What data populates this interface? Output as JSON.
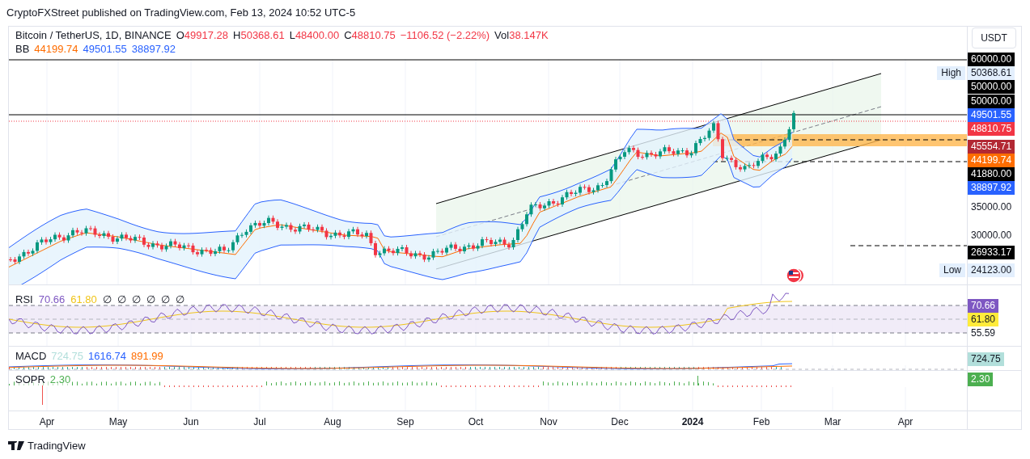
{
  "header": "CryptoFXStreet published on TradingView.com, Feb 13, 2024 10:52 UTC-5",
  "legend": {
    "symbol": "Bitcoin / TetherUS, 1D, BINANCE",
    "ohlc": [
      {
        "label": "O",
        "value": "49917.28"
      },
      {
        "label": "H",
        "value": "50368.61"
      },
      {
        "label": "L",
        "value": "48400.00"
      },
      {
        "label": "C",
        "value": "48810.75"
      }
    ],
    "change": "−1106.52 (−2.22%)",
    "volume": {
      "label": "Vol",
      "value": "38.147K"
    }
  },
  "bb": {
    "label": "BB",
    "values": [
      {
        "text": "44199.74",
        "color": "#ff6d00"
      },
      {
        "text": "49501.55",
        "color": "#2962ff"
      },
      {
        "text": "38897.92",
        "color": "#2962ff"
      }
    ]
  },
  "currency": "USDT",
  "price_labels": [
    {
      "text": "60000.00",
      "kind": "tag",
      "color": "#000000"
    },
    {
      "text": "50368.61",
      "kind": "tag",
      "color": "#e3effd",
      "marker": "High"
    },
    {
      "text": "50000.00",
      "kind": "tag",
      "color": "#000000"
    },
    {
      "text": "50000.00",
      "kind": "tag",
      "color": "#000000"
    },
    {
      "text": "49501.55",
      "kind": "tag",
      "color": "#2962ff"
    },
    {
      "text": "48810.75",
      "kind": "tag",
      "color": "#f23645"
    },
    {
      "text": "45554.71",
      "kind": "tag",
      "color": "#b22833"
    },
    {
      "text": "44199.74",
      "kind": "tag",
      "color": "#ff6d00"
    },
    {
      "text": "41880.00",
      "kind": "tag",
      "color": "#000000"
    },
    {
      "text": "38897.92",
      "kind": "tag",
      "color": "#2962ff"
    },
    {
      "text": "35000.00",
      "kind": "plain"
    },
    {
      "text": "30000.00",
      "kind": "plain"
    },
    {
      "text": "26933.17",
      "kind": "tag",
      "color": "#000000"
    },
    {
      "text": "24123.00",
      "kind": "tag",
      "color": "#e3effd",
      "marker": "Low"
    }
  ],
  "rsi": {
    "label": "RSI",
    "values": [
      {
        "text": "70.66",
        "color": "#7e57c2"
      },
      {
        "text": "61.80",
        "color": "#f0c419"
      }
    ],
    "empty_inputs": [
      "∅",
      "∅",
      "∅",
      "∅",
      "∅",
      "∅"
    ],
    "axis": [
      {
        "text": "70.66",
        "kind": "tag",
        "color": "#7e57c2"
      },
      {
        "text": "61.80",
        "kind": "tag",
        "color": "#ffeb3b"
      },
      {
        "text": "55.59",
        "kind": "plain"
      }
    ]
  },
  "macd": {
    "label": "MACD",
    "values": [
      {
        "text": "724.75",
        "color": "#b2dfdb"
      },
      {
        "text": "1616.74",
        "color": "#2962ff"
      },
      {
        "text": "891.99",
        "color": "#ff6d00"
      }
    ],
    "axis": [
      {
        "text": "724.75",
        "kind": "tag",
        "color": "#b2dfdb"
      }
    ]
  },
  "sopr": {
    "label": "SOPR",
    "values": [
      {
        "text": "2.30",
        "color": "#4caf50"
      }
    ],
    "axis": [
      {
        "text": "2.30",
        "kind": "tag",
        "color": "#4caf50"
      }
    ]
  },
  "time_axis": [
    {
      "text": "Apr",
      "bold": false
    },
    {
      "text": "May",
      "bold": false
    },
    {
      "text": "Jun",
      "bold": false
    },
    {
      "text": "Jul",
      "bold": false
    },
    {
      "text": "Aug",
      "bold": false
    },
    {
      "text": "Sep",
      "bold": false
    },
    {
      "text": "Oct",
      "bold": false
    },
    {
      "text": "Nov",
      "bold": false
    },
    {
      "text": "Dec",
      "bold": false
    },
    {
      "text": "2024",
      "bold": true
    },
    {
      "text": "Feb",
      "bold": false
    },
    {
      "text": "Mar",
      "bold": false
    },
    {
      "text": "Apr",
      "bold": false
    }
  ],
  "footer": "TradingView"
}
